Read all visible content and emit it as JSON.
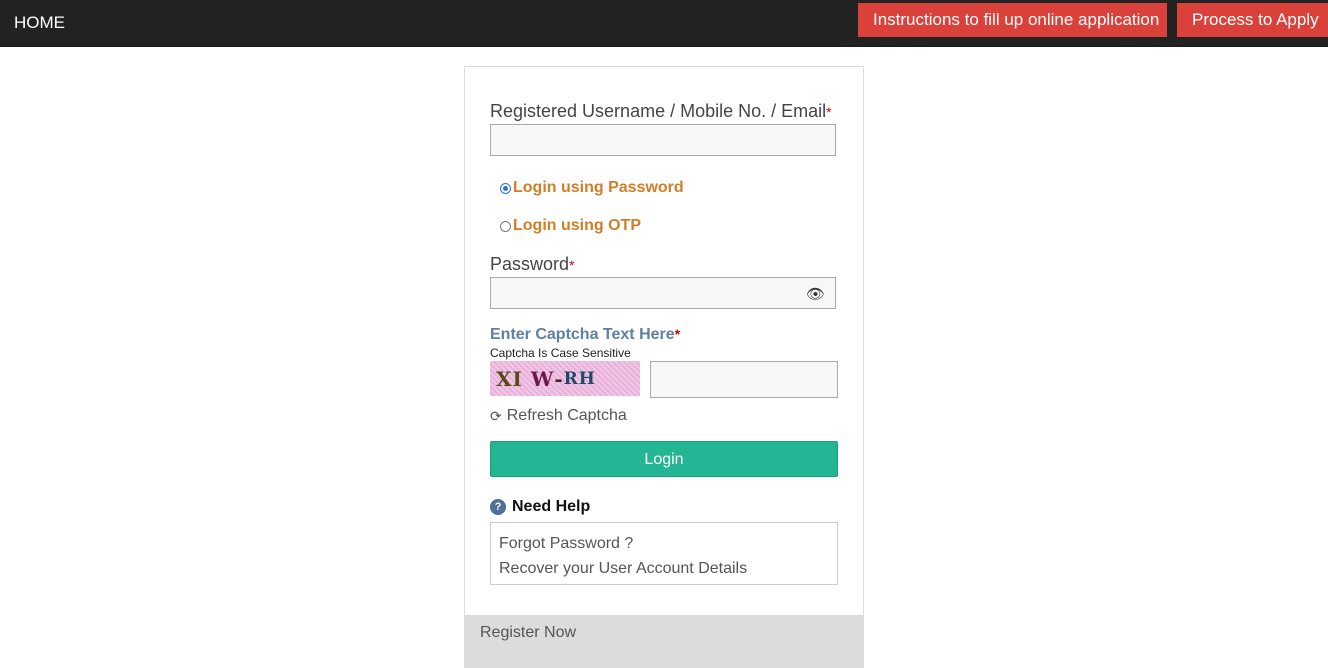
{
  "nav": {
    "home": "HOME",
    "instructions": "Instructions to fill up online application",
    "process": "Process to Apply"
  },
  "form": {
    "username_label": "Registered Username / Mobile No. / Email",
    "required_mark": "*",
    "username_value": "",
    "login_options": [
      {
        "label": "Login using Password",
        "selected": true
      },
      {
        "label": "Login using OTP",
        "selected": false
      }
    ],
    "password_label": "Password",
    "password_value": "",
    "eye_icon": "👁",
    "captcha_title": "Enter Captcha Text Here",
    "captcha_note": "Captcha Is Case Sensitive",
    "captcha_chars": [
      {
        "text": "XI",
        "color": "#5a4a1a"
      },
      {
        "text": "W",
        "color": "#6a1a4a"
      },
      {
        "text": "-",
        "color": "#3a2a2a"
      },
      {
        "text": "RH",
        "color": "#1e4a6a"
      }
    ],
    "captcha_value": "",
    "refresh_icon": "⟳",
    "refresh_label": "Refresh Captcha",
    "login_button": "Login"
  },
  "help": {
    "icon": "?",
    "title": "Need Help",
    "links": [
      "Forgot Password ?",
      "Recover your User Account Details"
    ]
  },
  "register": {
    "label": "Register Now"
  },
  "colors": {
    "nav_bg": "#222222",
    "nav_button": "#d9413a",
    "login_button": "#24b592",
    "radio_label": "#d17e28",
    "captcha_title": "#5f7fa4"
  }
}
